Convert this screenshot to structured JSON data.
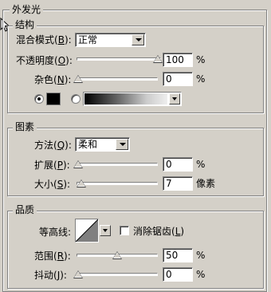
{
  "outer_glow": {
    "title": "外发光",
    "structure": {
      "title": "结构",
      "blend_mode": {
        "label": "混合模式",
        "mnemonic": "B",
        "value": "正常"
      },
      "opacity": {
        "label": "不透明度",
        "mnemonic": "O",
        "value": "100",
        "unit": "%",
        "level": 1.0
      },
      "noise": {
        "label": "杂色",
        "mnemonic": "N",
        "value": "0",
        "unit": "%",
        "level": 0.0
      },
      "color_mode": "solid",
      "solid_color": "#000000"
    },
    "elements": {
      "title": "图素",
      "technique": {
        "label": "方法",
        "mnemonic": "Q",
        "value": "柔和"
      },
      "spread": {
        "label": "扩展",
        "mnemonic": "P",
        "value": "0",
        "unit": "%",
        "level": 0.0
      },
      "size": {
        "label": "大小",
        "mnemonic": "S",
        "value": "7",
        "unit": "像素",
        "level": 0.04
      }
    },
    "quality": {
      "title": "品质",
      "contour": {
        "label": "等高线"
      },
      "anti_alias": {
        "label": "消除锯齿",
        "mnemonic": "L",
        "checked": false
      },
      "range": {
        "label": "范围",
        "mnemonic": "R",
        "value": "50",
        "unit": "%",
        "level": 0.5
      },
      "jitter": {
        "label": "抖动",
        "mnemonic": "J",
        "value": "0",
        "unit": "%",
        "level": 0.0
      }
    }
  }
}
